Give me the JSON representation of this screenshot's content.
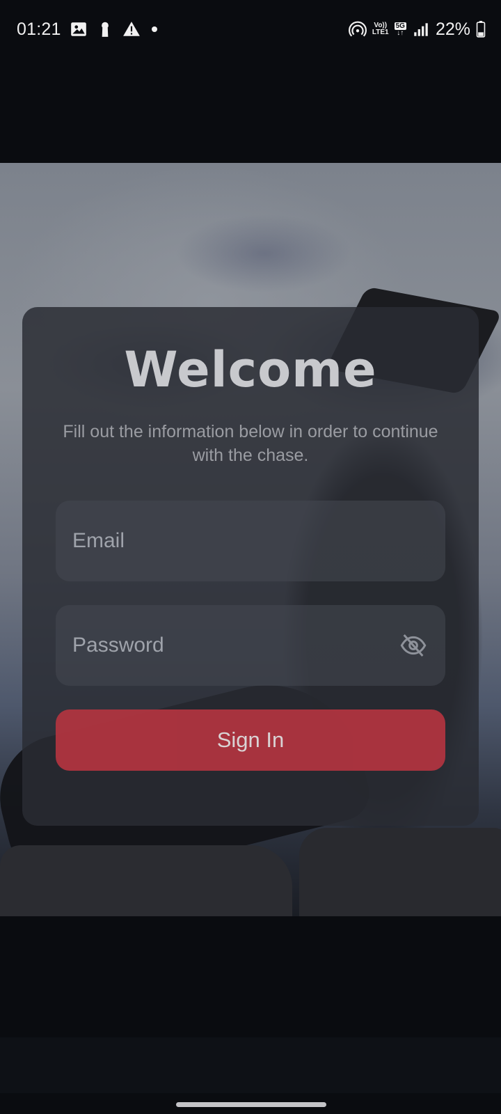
{
  "status_bar": {
    "time": "01:21",
    "battery": "22%",
    "volte_label": "Vo))",
    "lte_label": "LTE1",
    "network": "5G",
    "icons": [
      "gallery-icon",
      "keyhole-icon",
      "warning-icon",
      "notification-dot-icon",
      "hotspot-icon",
      "signal-icon",
      "battery-icon"
    ]
  },
  "login": {
    "title": "Welcome",
    "subtitle": "Fill out the information below in order to continue with the chase.",
    "email_placeholder": "Email",
    "password_placeholder": "Password",
    "sign_in_label": "Sign In"
  },
  "colors": {
    "accent": "#b33440",
    "card": "#2a2c33",
    "background": "#0a0c10"
  }
}
